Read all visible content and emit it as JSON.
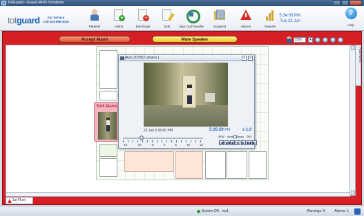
{
  "window": {
    "title": "TotGuard - Guard RFID Solutions"
  },
  "branding": {
    "logo_prefix": "tot",
    "logo_suffix": "guard",
    "support_line1": "For Service",
    "support_line2": "Call 604-998-4018"
  },
  "toolbar": {
    "items": [
      {
        "label": "Patients",
        "icon": "patients-icon"
      },
      {
        "label": "Admit",
        "icon": "admit-icon"
      },
      {
        "label": "Discharge",
        "icon": "discharge-icon"
      },
      {
        "label": "Edit",
        "icon": "edit-icon"
      },
      {
        "label": "Sign Out/Transfer",
        "icon": "sign-out-transfer-icon"
      },
      {
        "label": "Suspend",
        "icon": "suspend-icon"
      },
      {
        "label": "Alarms",
        "icon": "alarm-warning-icon"
      },
      {
        "label": "Reports",
        "icon": "reports-icon"
      }
    ],
    "help_label": "Help"
  },
  "clock": {
    "time": "5:34:05 PM",
    "date": "Tue 23 Jun"
  },
  "actions": {
    "accept_alarm": "Accept Alarm",
    "mute_speaker": "Mute Speaker"
  },
  "zoom": {
    "value": "25%"
  },
  "side_tab": {
    "label": "Add Alerts"
  },
  "camera": {
    "title": "[Axis 207W] Camera 1",
    "timestamp_left": "23 Jun 5:35:50 PM",
    "timestamp_right": "5:35:59",
    "timestamp_right_suffix": "PM",
    "speed": "x 1.0",
    "slow_label": "slow",
    "fast_label": "fast",
    "timeline_labels": [
      "-15",
      "-10",
      "-5",
      "0",
      "5",
      "10",
      "15"
    ]
  },
  "exit_alarm": {
    "label": "Exit Alarm"
  },
  "floor_tab": {
    "label": "1st Floor"
  },
  "status": {
    "system": "System OK - wo1",
    "warnings": "Warnings: 0",
    "alarms": "Alarms: 1"
  }
}
